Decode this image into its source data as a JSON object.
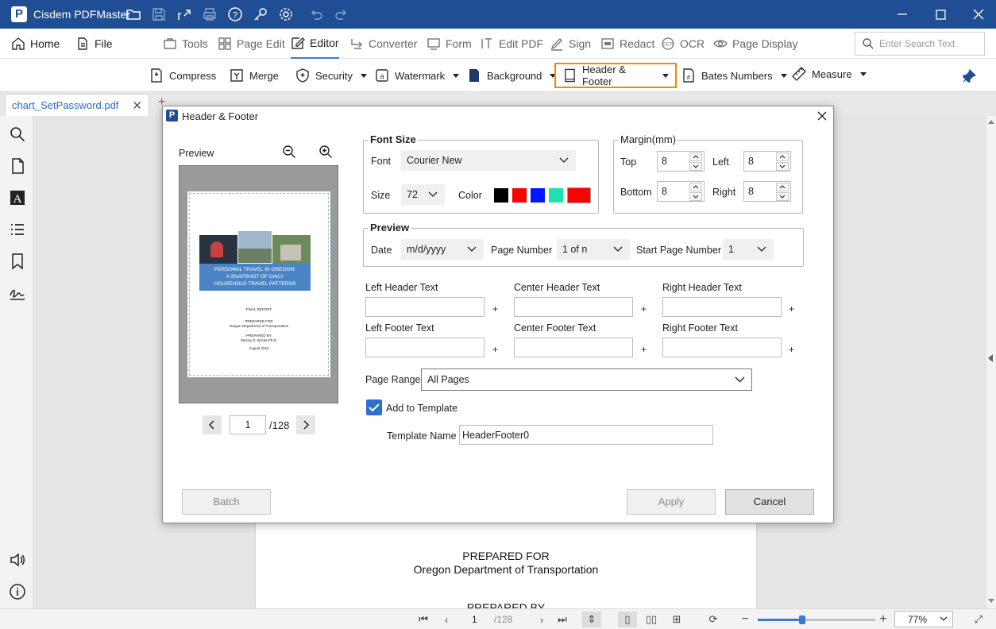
{
  "app": {
    "title": "Cisdem PDFMaster",
    "logo_letter": "P"
  },
  "menu": {
    "home": "Home",
    "file": "File",
    "tools": "Tools",
    "page_edit": "Page Edit",
    "editor": "Editor",
    "converter": "Converter",
    "form": "Form",
    "edit_pdf": "Edit PDF",
    "sign": "Sign",
    "redact": "Redact",
    "ocr": "OCR",
    "page_display": "Page Display"
  },
  "search": {
    "placeholder": "Enter Search Text"
  },
  "ribbon": {
    "compress": "Compress",
    "merge": "Merge",
    "security": "Security",
    "watermark": "Watermark",
    "background": "Background",
    "header_footer": "Header & Footer",
    "bates": "Bates Numbers",
    "measure": "Measure"
  },
  "tab": {
    "name": "chart_SetPassword.pdf"
  },
  "page_content": {
    "line1": "PREPARED FOR",
    "line2": "Oregon Department of Transportation",
    "line3": "PREPARED BY"
  },
  "status": {
    "page": "1",
    "total": "/128",
    "zoom": "77%"
  },
  "dialog": {
    "title": "Header & Footer",
    "preview_label": "Preview",
    "thumb": {
      "banner": "PERSONAL TRAVEL IN OREGON:\nA SNAPSHOT OF DAILY\nHOUSEHOLD TRAVEL PATTERNS",
      "final": "FINAL REPORT",
      "prep_for": "PREPARED FOR",
      "odot": "Oregon Department of Transportation",
      "prep_by": "PREPARED BY",
      "author": "Stacey G. Bricka Ph.D.",
      "date": "August 2016"
    },
    "page_input": "1",
    "page_total": "/128",
    "font_size": {
      "title": "Font Size",
      "font_label": "Font",
      "font_value": "Courier New",
      "size_label": "Size",
      "size_value": "72",
      "color_label": "Color"
    },
    "colors": [
      "#000000",
      "#ff0000",
      "#0018ff",
      "#1ee0b0",
      "#ff0000"
    ],
    "margin": {
      "title": "Margin(mm)",
      "top_label": "Top",
      "top": "8",
      "left_label": "Left",
      "left": "8",
      "bottom_label": "Bottom",
      "bottom": "8",
      "right_label": "Right",
      "right": "8"
    },
    "preview_group": {
      "title": "Preview",
      "date_label": "Date",
      "date_value": "m/d/yyyy",
      "page_number_label": "Page Number",
      "page_number_value": "1 of n",
      "start_label": "Start Page Number",
      "start_value": "1"
    },
    "texts": {
      "lh": "Left Header Text",
      "ch": "Center Header Text",
      "rh": "Right Header Text",
      "lf": "Left Footer Text",
      "cf": "Center Footer Text",
      "rf": "Right Footer Text",
      "plus": "+"
    },
    "page_range": {
      "label": "Page Range",
      "value": "All Pages"
    },
    "add_template": {
      "label": "Add to Template",
      "checked": true
    },
    "template_name": {
      "label": "Template Name",
      "value": "HeaderFooter0"
    },
    "buttons": {
      "batch": "Batch",
      "apply": "Apply",
      "cancel": "Cancel"
    }
  }
}
